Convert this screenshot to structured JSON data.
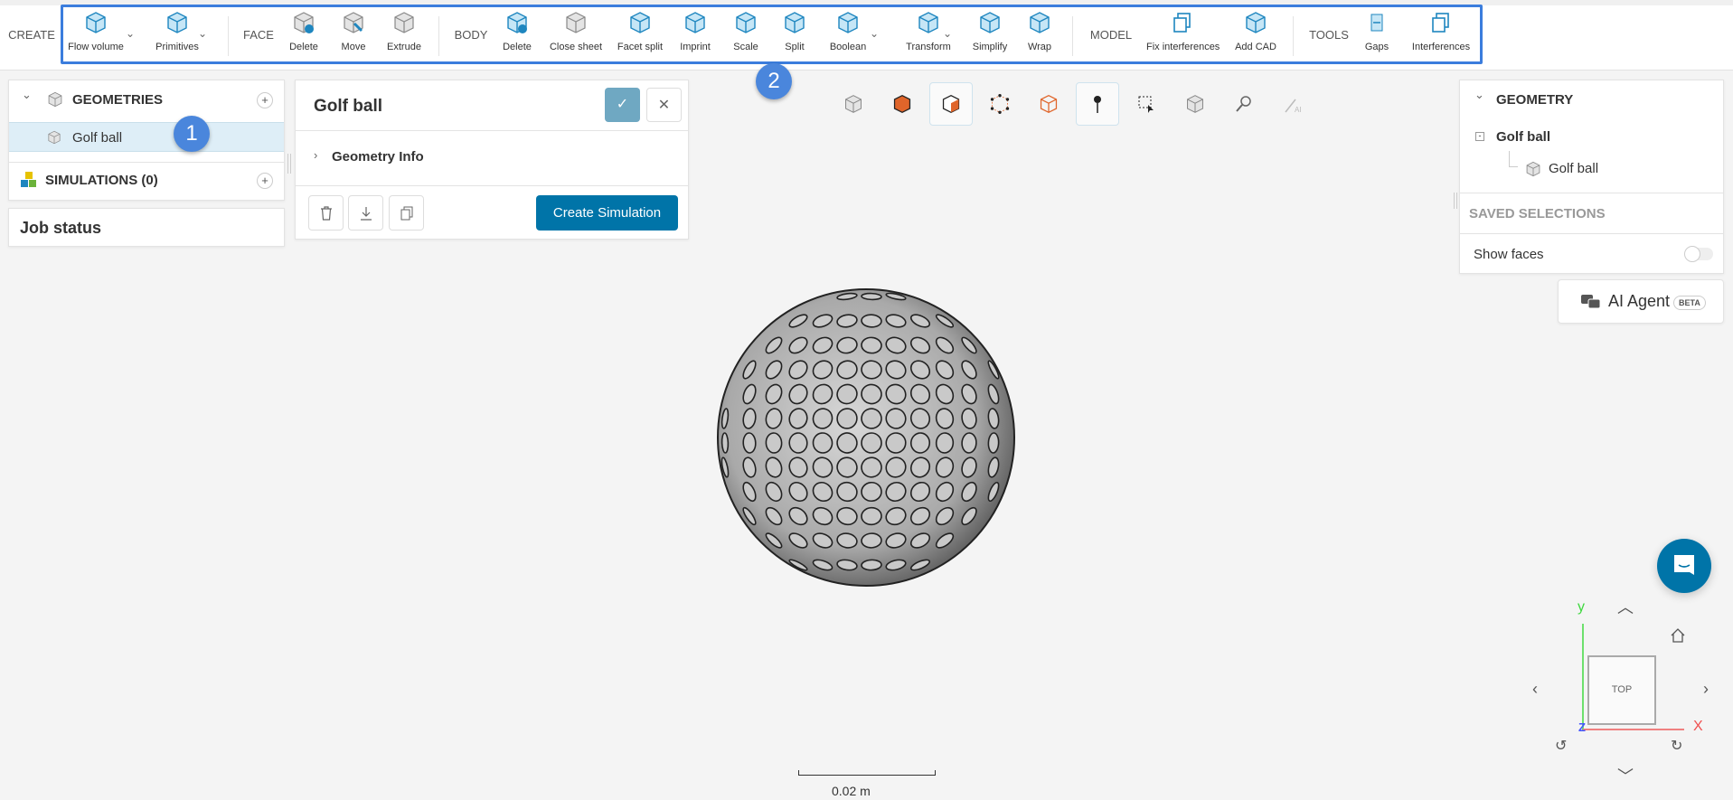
{
  "toolbar": {
    "sections": {
      "create": "CREATE",
      "face": "FACE",
      "body": "BODY",
      "model": "MODEL",
      "tools": "TOOLS"
    },
    "items": {
      "flow_volume": "Flow volume",
      "primitives": "Primitives",
      "face_delete": "Delete",
      "move": "Move",
      "extrude": "Extrude",
      "body_delete": "Delete",
      "close_sheet": "Close sheet",
      "facet_split": "Facet split",
      "imprint": "Imprint",
      "scale": "Scale",
      "split": "Split",
      "boolean": "Boolean",
      "transform": "Transform",
      "simplify": "Simplify",
      "wrap": "Wrap",
      "fix_interferences": "Fix interferences",
      "add_cad": "Add CAD",
      "gaps": "Gaps",
      "interferences": "Interferences"
    },
    "chevron": "⌄"
  },
  "annotations": {
    "badge1": "1",
    "badge2": "2"
  },
  "left": {
    "geometries": "GEOMETRIES",
    "geometry_item": "Golf ball",
    "simulations": "SIMULATIONS (0)",
    "job_status": "Job status",
    "plus": "+"
  },
  "detail": {
    "title": "Golf ball",
    "geometry_info": "Geometry Info",
    "create_simulation": "Create Simulation"
  },
  "right": {
    "geometry": "GEOMETRY",
    "parent": "Golf ball",
    "child": "Golf ball",
    "saved_selections": "SAVED SELECTIONS",
    "show_faces": "Show faces",
    "show_faces_on": false,
    "ai_agent": "AI Agent",
    "beta": "BETA"
  },
  "viewport": {
    "scale_label": "0.02 m",
    "nav": {
      "top": "TOP",
      "x": "X",
      "y": "Y",
      "z": "Z"
    }
  },
  "colors": {
    "accent": "#0074a8",
    "badge": "#4a86dc",
    "selected_row": "#deeef7",
    "icon_blue": "#1e86bf"
  }
}
